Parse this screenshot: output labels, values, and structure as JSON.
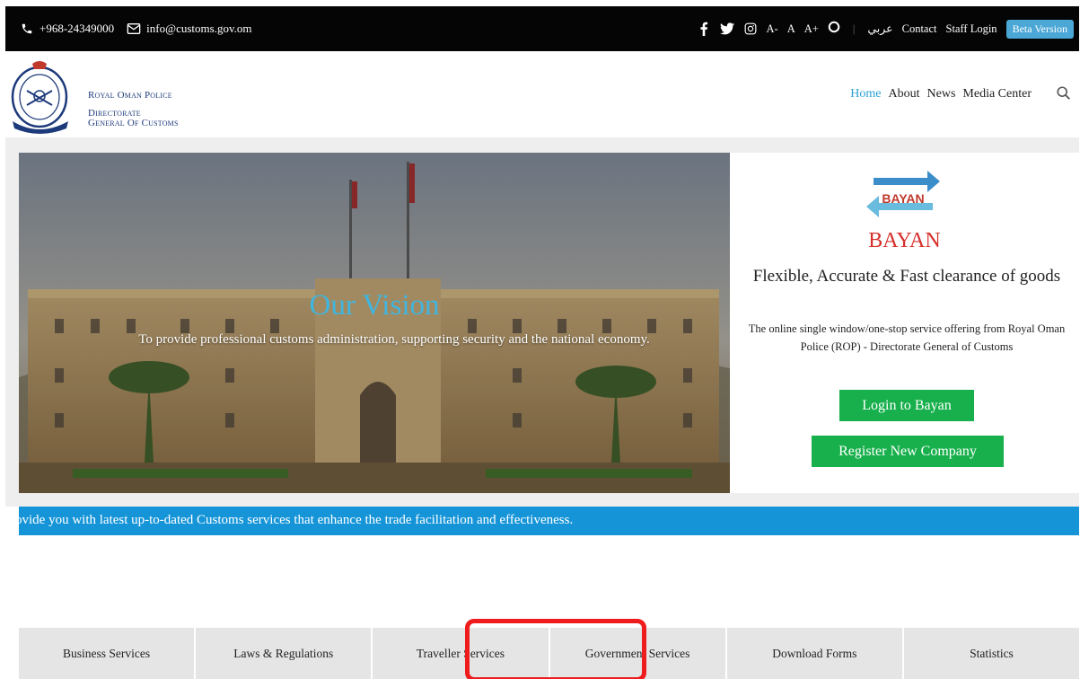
{
  "topbar": {
    "phone": "+968-24349000",
    "email": "info@customs.gov.om",
    "social": [
      "facebook-icon",
      "twitter-icon",
      "instagram-icon"
    ],
    "font_small": "A-",
    "font_normal": "A",
    "font_large": "A+",
    "contrast": "O",
    "arabic": "عربي",
    "contact": "Contact",
    "staff_login": "Staff Login",
    "beta": "Beta Version"
  },
  "header": {
    "brand_line1": "Royal Oman Police",
    "brand_line2a": "Directorate",
    "brand_line2b": "General Of Customs",
    "nav": [
      "Home",
      "About",
      "News",
      "Media Center"
    ],
    "active_nav": "Home"
  },
  "hero": {
    "title": "Our Vision",
    "text": "To provide professional customs administration, supporting security and the national economy."
  },
  "bayan": {
    "logo_text": "BAYAN",
    "name": "BAYAN",
    "tagline": "Flexible, Accurate & Fast clearance of goods",
    "description": "The online single window/one-stop service offering from Royal Oman Police (ROP) - Directorate General of Customs",
    "login_label": "Login to Bayan",
    "register_label": "Register New Company"
  },
  "ticker": {
    "text": "ovide you with latest up-to-dated Customs services that enhance the trade facilitation and effectiveness."
  },
  "services": [
    "Business Services",
    "Laws & Regulations",
    "Traveller Services",
    "Government Services",
    "Download Forms",
    "Statistics"
  ],
  "colors": {
    "accent": "#2aa1d3",
    "green": "#18b04c",
    "ticker": "#1595d8",
    "bayan_red": "#d6302b",
    "highlight": "#ee1c1c"
  }
}
